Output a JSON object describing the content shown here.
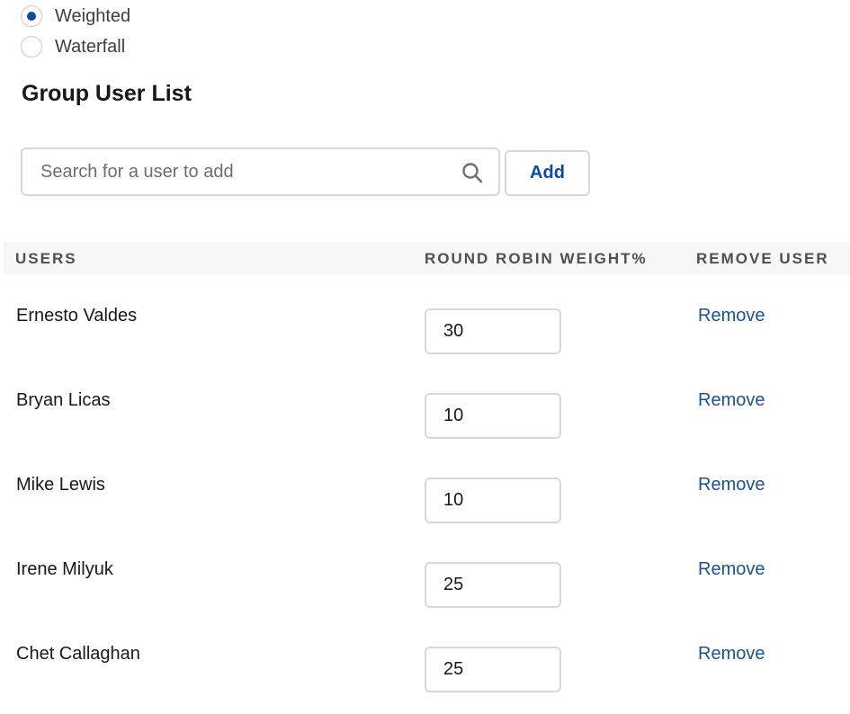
{
  "routing": {
    "options": [
      {
        "label": "Weighted",
        "selected": true
      },
      {
        "label": "Waterfall",
        "selected": false
      }
    ]
  },
  "group": {
    "title": "Group User List",
    "search": {
      "placeholder": "Search for a user to add",
      "value": ""
    },
    "add_label": "Add"
  },
  "table": {
    "headers": {
      "users": "USERS",
      "weight": "ROUND ROBIN WEIGHT%",
      "remove": "REMOVE USER"
    },
    "rows": [
      {
        "name": "Ernesto Valdes",
        "weight": "30",
        "remove_label": "Remove"
      },
      {
        "name": "Bryan Licas",
        "weight": "10",
        "remove_label": "Remove"
      },
      {
        "name": "Mike Lewis",
        "weight": "10",
        "remove_label": "Remove"
      },
      {
        "name": "Irene Milyuk",
        "weight": "25",
        "remove_label": "Remove"
      },
      {
        "name": "Chet Callaghan",
        "weight": "25",
        "remove_label": "Remove"
      }
    ]
  },
  "colors": {
    "accent": "#0b4aa8",
    "link": "#1b5297",
    "header_bg": "#f8f7f5",
    "border": "#d8d8d8"
  },
  "icons": {
    "search": "search-icon"
  }
}
